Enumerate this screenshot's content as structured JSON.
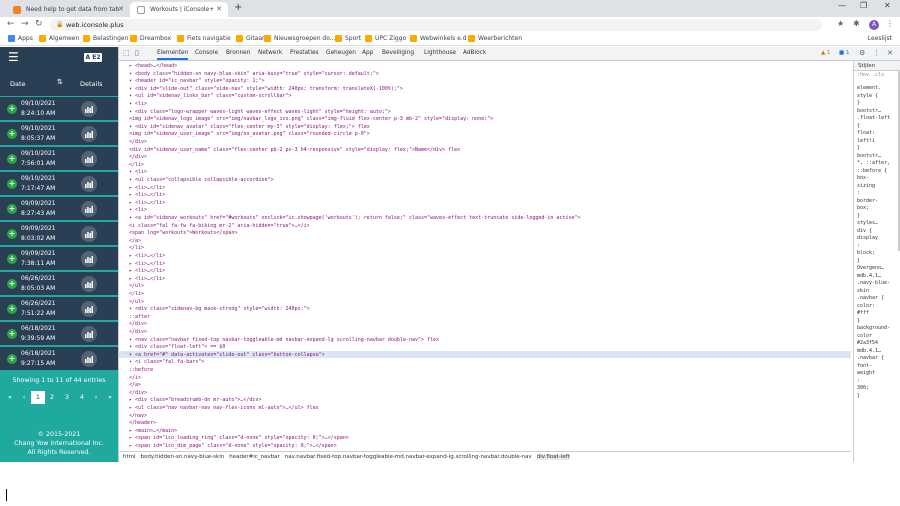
{
  "browser": {
    "tabs": [
      {
        "title": "Need help to get data from tab"
      },
      {
        "title": "Workouts | iConsole+"
      }
    ],
    "url": "web.iconsole.plus",
    "bookmarks": [
      "Apps",
      "Algemeen",
      "Belastingen",
      "Dreambox",
      "Fiets navigatie",
      "Gitaar",
      "Nieuwsgroepen do...",
      "Sport",
      "UPC Ziggo",
      "Webwinkels e.d",
      "Weerberichten"
    ],
    "reading_list": "Leeslijst",
    "profile_initial": "A"
  },
  "app": {
    "badge": "A E2",
    "columns": {
      "date": "Date",
      "details": "Details"
    },
    "rows": [
      {
        "date": "09/10/2021",
        "time": "8:24:10 AM"
      },
      {
        "date": "09/10/2021",
        "time": "8:05:37 AM"
      },
      {
        "date": "09/10/2021",
        "time": "7:56:01 AM"
      },
      {
        "date": "09/10/2021",
        "time": "7:17:47 AM"
      },
      {
        "date": "09/09/2021",
        "time": "8:27:43 AM"
      },
      {
        "date": "09/09/2021",
        "time": "8:03:02 AM"
      },
      {
        "date": "09/09/2021",
        "time": "7:38:11 AM"
      },
      {
        "date": "06/26/2021",
        "time": "8:05:03 AM"
      },
      {
        "date": "06/26/2021",
        "time": "7:51:22 AM"
      },
      {
        "date": "06/18/2021",
        "time": "9:39:59 AM"
      },
      {
        "date": "06/18/2021",
        "time": "9:27:15 AM"
      }
    ],
    "showing": "Showing 1 to 11 of 44 entries",
    "pager": {
      "first": "«",
      "prev": "‹",
      "pages": [
        "1",
        "2",
        "3",
        "4"
      ],
      "next": "›",
      "last": "»",
      "active": "1"
    },
    "footer": [
      "© 2015-2021",
      "Chang Yow International Inc.",
      "All Rights Reserved."
    ]
  },
  "devtools": {
    "tabs": [
      "Elementen",
      "Console",
      "Bronnen",
      "Netwerk",
      "Prestaties",
      "Geheugen",
      "App",
      "Beveiliging",
      "Lighthouse",
      "AdBlock"
    ],
    "active_tab": "Elementen",
    "warnings": "1",
    "messages": "1",
    "code_lines": [
      "▸ <head>…</head>",
      "▾ <body class=\"hidden-sn navy-blue-skin\" aria-busy=\"true\" style=\"cursor: default;\">",
      "  ▾ <header id=\"ic_navbar\" style=\"opacity: 1;\">",
      "    ▾ <div id=\"slide-out\" class=\"side-nav\" style=\"width: 240px; transform: translateX(-100%);\">",
      "      ▾ <ul id=\"sidenav_links_bar\" class=\"custom-scrollbar\">",
      "        ▾ <li>",
      "          ▾ <div class=\"logo-wrapper waves-light waves-effect waves-light\" style=\"height: auto;\">",
      "              <img id=\"sidenav_logo_image\" src=\"img/navbar_logo_ico.png\" class=\"img-fluid flex-center p-3 mb-2\" style=\"display: none;\">",
      "            ▾ <div id=\"sidenav_avatar\" class=\"flex-center my-3\" style=\"display: flex;\"> flex",
      "                <img id=\"sidenav_user_image\" src=\"img/no_avatar.png\" class=\"rounded-circle p-0\">",
      "              </div>",
      "              <div id=\"sidenav_user_name\" class=\"flex-center pb-2 px-3 h4-responsive\" style=\"display: flex;\">Name</div> flex",
      "            </div>",
      "          </li>",
      "        ▾ <li>",
      "          ▾ <ul class=\"collapsible collapsible-accordion\">",
      "            ▸ <li>…</li>",
      "            ▸ <li>…</li>",
      "            ▸ <li>…</li>",
      "            ▾ <li>",
      "              ▾ <a id=\"sidenav_workouts\" href=\"#workouts\" onclick=\"ic.showpage('workouts'); return false;\" class=\"waves-effect text-truncate side-logged-in active\">",
      "                  <i class=\"fal fa-fw fa-biking mr-2\" aria-hidden=\"true\">…</i>",
      "                  <span lng=\"workouts\">Workouts</span>",
      "                </a>",
      "              </li>",
      "            ▸ <li>…</li>",
      "            ▸ <li>…</li>",
      "            ▸ <li>…</li>",
      "            ▸ <li>…</li>",
      "            </ul>",
      "          </li>",
      "        </ul>",
      "      ▾ <div class=\"sidenav-bg mask-strong\" style=\"width: 240px;\">",
      "          ::after",
      "        </div>",
      "      </div>",
      "  ▾ <nav class=\"navbar fixed-top navbar-toggleable-md navbar-expand-lg scrolling-navbar double-nav\"> flex",
      "    ▾ <div class=\"float-left\"> == $0",
      "      ▾ <a href=\"#\" data-activates=\"slide-out\" class=\"button-collapse\">",
      "        ▾ <i class=\"fal fa-bars\">",
      "            ::before",
      "          </i>",
      "        </a>",
      "      </div>",
      "    ▸ <div class=\"breadcrumb-dn mr-auto\">…</div>",
      "    ▸ <ul class=\"nav navbar-nav nav-flex-icons ml-auto\">…</ul> flex",
      "    </nav>",
      "  </header>",
      "  ▸ <main>…</main>",
      "  ▸ <span id=\"ico_loading_ring\" class=\"d-none\" style=\"opacity: 0;\">…</span>",
      "  ▸ <span id=\"ico_dim_page\" class=\"d-none\" style=\"opacity: 0;\">…</span>"
    ],
    "breadcrumbs": [
      "html",
      "body.hidden-sn.navy-blue-skin",
      "header#ic_navbar",
      "nav.navbar.fixed-top.navbar-toggleable-md.navbar-expand-lg.scrolling-navbar.double-nav",
      "div.float-left"
    ],
    "styles": {
      "tabs": "Stijlen",
      "filter": ":hov .cls",
      "lines": [
        "element.",
        "style {",
        "}",
        "bootstr…",
        ".float-left",
        "{",
        "float:",
        "left!i",
        "}",
        "bootstr…",
        "*, ::after,",
        "::before {",
        "box-",
        "sizing",
        ":",
        "border-",
        "box;",
        "}",
        "styles…",
        "div {",
        "display",
        ":",
        "block;",
        "}",
        "Overgeno…",
        "mdb.4.1…",
        ".navy-blue-",
        "skin",
        ".navbar {",
        "color:",
        "#fff",
        "}",
        "background-",
        "color",
        "#2a3f54",
        "mdb.4.1…",
        ".navbar {",
        "font-",
        "weight",
        ":",
        "300;",
        "}"
      ]
    }
  }
}
